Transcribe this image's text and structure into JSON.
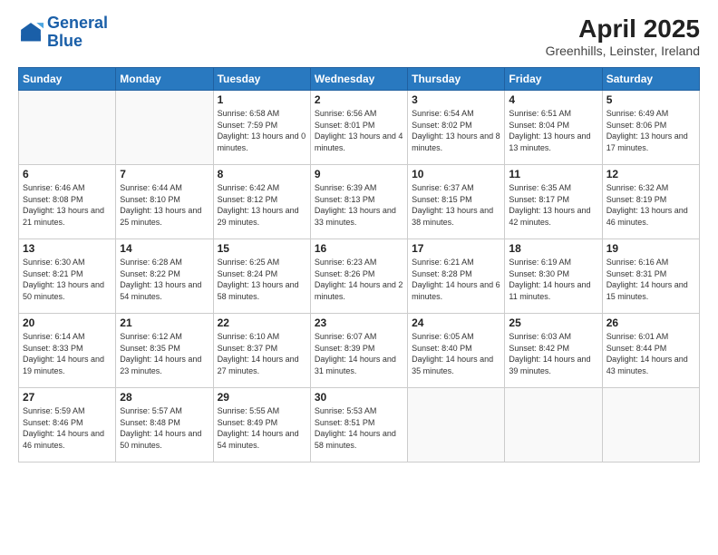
{
  "logo": {
    "line1": "General",
    "line2": "Blue"
  },
  "title": "April 2025",
  "subtitle": "Greenhills, Leinster, Ireland",
  "days_of_week": [
    "Sunday",
    "Monday",
    "Tuesday",
    "Wednesday",
    "Thursday",
    "Friday",
    "Saturday"
  ],
  "weeks": [
    [
      {
        "day": "",
        "info": ""
      },
      {
        "day": "",
        "info": ""
      },
      {
        "day": "1",
        "info": "Sunrise: 6:58 AM\nSunset: 7:59 PM\nDaylight: 13 hours and 0 minutes."
      },
      {
        "day": "2",
        "info": "Sunrise: 6:56 AM\nSunset: 8:01 PM\nDaylight: 13 hours and 4 minutes."
      },
      {
        "day": "3",
        "info": "Sunrise: 6:54 AM\nSunset: 8:02 PM\nDaylight: 13 hours and 8 minutes."
      },
      {
        "day": "4",
        "info": "Sunrise: 6:51 AM\nSunset: 8:04 PM\nDaylight: 13 hours and 13 minutes."
      },
      {
        "day": "5",
        "info": "Sunrise: 6:49 AM\nSunset: 8:06 PM\nDaylight: 13 hours and 17 minutes."
      }
    ],
    [
      {
        "day": "6",
        "info": "Sunrise: 6:46 AM\nSunset: 8:08 PM\nDaylight: 13 hours and 21 minutes."
      },
      {
        "day": "7",
        "info": "Sunrise: 6:44 AM\nSunset: 8:10 PM\nDaylight: 13 hours and 25 minutes."
      },
      {
        "day": "8",
        "info": "Sunrise: 6:42 AM\nSunset: 8:12 PM\nDaylight: 13 hours and 29 minutes."
      },
      {
        "day": "9",
        "info": "Sunrise: 6:39 AM\nSunset: 8:13 PM\nDaylight: 13 hours and 33 minutes."
      },
      {
        "day": "10",
        "info": "Sunrise: 6:37 AM\nSunset: 8:15 PM\nDaylight: 13 hours and 38 minutes."
      },
      {
        "day": "11",
        "info": "Sunrise: 6:35 AM\nSunset: 8:17 PM\nDaylight: 13 hours and 42 minutes."
      },
      {
        "day": "12",
        "info": "Sunrise: 6:32 AM\nSunset: 8:19 PM\nDaylight: 13 hours and 46 minutes."
      }
    ],
    [
      {
        "day": "13",
        "info": "Sunrise: 6:30 AM\nSunset: 8:21 PM\nDaylight: 13 hours and 50 minutes."
      },
      {
        "day": "14",
        "info": "Sunrise: 6:28 AM\nSunset: 8:22 PM\nDaylight: 13 hours and 54 minutes."
      },
      {
        "day": "15",
        "info": "Sunrise: 6:25 AM\nSunset: 8:24 PM\nDaylight: 13 hours and 58 minutes."
      },
      {
        "day": "16",
        "info": "Sunrise: 6:23 AM\nSunset: 8:26 PM\nDaylight: 14 hours and 2 minutes."
      },
      {
        "day": "17",
        "info": "Sunrise: 6:21 AM\nSunset: 8:28 PM\nDaylight: 14 hours and 6 minutes."
      },
      {
        "day": "18",
        "info": "Sunrise: 6:19 AM\nSunset: 8:30 PM\nDaylight: 14 hours and 11 minutes."
      },
      {
        "day": "19",
        "info": "Sunrise: 6:16 AM\nSunset: 8:31 PM\nDaylight: 14 hours and 15 minutes."
      }
    ],
    [
      {
        "day": "20",
        "info": "Sunrise: 6:14 AM\nSunset: 8:33 PM\nDaylight: 14 hours and 19 minutes."
      },
      {
        "day": "21",
        "info": "Sunrise: 6:12 AM\nSunset: 8:35 PM\nDaylight: 14 hours and 23 minutes."
      },
      {
        "day": "22",
        "info": "Sunrise: 6:10 AM\nSunset: 8:37 PM\nDaylight: 14 hours and 27 minutes."
      },
      {
        "day": "23",
        "info": "Sunrise: 6:07 AM\nSunset: 8:39 PM\nDaylight: 14 hours and 31 minutes."
      },
      {
        "day": "24",
        "info": "Sunrise: 6:05 AM\nSunset: 8:40 PM\nDaylight: 14 hours and 35 minutes."
      },
      {
        "day": "25",
        "info": "Sunrise: 6:03 AM\nSunset: 8:42 PM\nDaylight: 14 hours and 39 minutes."
      },
      {
        "day": "26",
        "info": "Sunrise: 6:01 AM\nSunset: 8:44 PM\nDaylight: 14 hours and 43 minutes."
      }
    ],
    [
      {
        "day": "27",
        "info": "Sunrise: 5:59 AM\nSunset: 8:46 PM\nDaylight: 14 hours and 46 minutes."
      },
      {
        "day": "28",
        "info": "Sunrise: 5:57 AM\nSunset: 8:48 PM\nDaylight: 14 hours and 50 minutes."
      },
      {
        "day": "29",
        "info": "Sunrise: 5:55 AM\nSunset: 8:49 PM\nDaylight: 14 hours and 54 minutes."
      },
      {
        "day": "30",
        "info": "Sunrise: 5:53 AM\nSunset: 8:51 PM\nDaylight: 14 hours and 58 minutes."
      },
      {
        "day": "",
        "info": ""
      },
      {
        "day": "",
        "info": ""
      },
      {
        "day": "",
        "info": ""
      }
    ]
  ]
}
